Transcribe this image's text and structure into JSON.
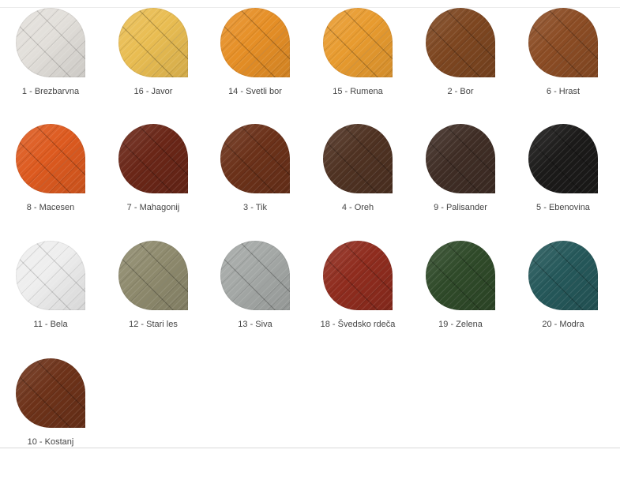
{
  "swatches": [
    {
      "label": "1 - Brezbarvna",
      "color": "#e2dfda",
      "tone": "light"
    },
    {
      "label": "16 - Javor",
      "color": "#e9bd52",
      "tone": "mid"
    },
    {
      "label": "14 - Svetli bor",
      "color": "#e68f26",
      "tone": "mid"
    },
    {
      "label": "15 - Rumena",
      "color": "#e89b2f",
      "tone": "mid"
    },
    {
      "label": "2 - Bor",
      "color": "#7d4620",
      "tone": "dark"
    },
    {
      "label": "6 - Hrast",
      "color": "#8b4c24",
      "tone": "dark"
    },
    {
      "label": "8 - Macesen",
      "color": "#dd5a1f",
      "tone": "mid"
    },
    {
      "label": "7 - Mahagonij",
      "color": "#6a2617",
      "tone": "dark"
    },
    {
      "label": "3 - Tik",
      "color": "#6b3119",
      "tone": "dark"
    },
    {
      "label": "4 - Oreh",
      "color": "#4f3222",
      "tone": "dark"
    },
    {
      "label": "9 - Palisander",
      "color": "#3f2d25",
      "tone": "dark"
    },
    {
      "label": "5 - Ebenovina",
      "color": "#1b1a19",
      "tone": "dark"
    },
    {
      "label": "11 - Bela",
      "color": "#eeeeee",
      "tone": "light"
    },
    {
      "label": "12 - Stari les",
      "color": "#8e8a6d",
      "tone": "mid"
    },
    {
      "label": "13 - Siva",
      "color": "#a4a8a6",
      "tone": "mid"
    },
    {
      "label": "18 - Švedsko rdeča",
      "color": "#8f2c1e",
      "tone": "dark"
    },
    {
      "label": "19 - Zelena",
      "color": "#2f4a29",
      "tone": "dark"
    },
    {
      "label": "20 - Modra",
      "color": "#25585a",
      "tone": "dark"
    },
    {
      "label": "10 - Kostanj",
      "color": "#6d3219",
      "tone": "dark"
    }
  ]
}
